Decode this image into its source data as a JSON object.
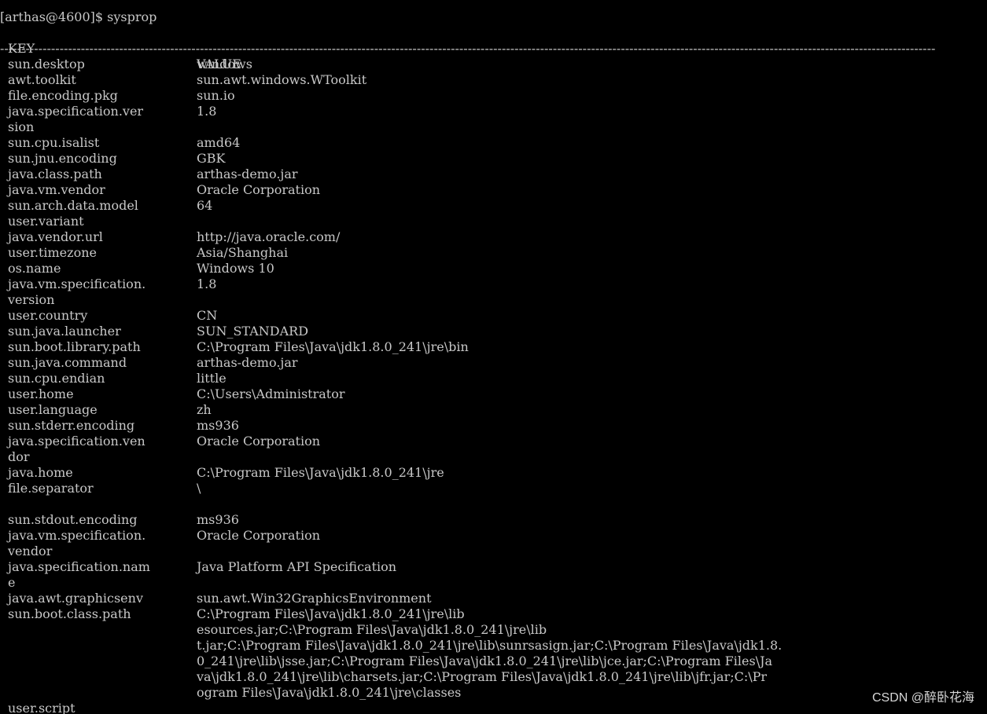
{
  "terminal": {
    "prompt": "[arthas@4600]$ ",
    "command": "sysprop",
    "header": {
      "key": "KEY",
      "value": "VALUE"
    },
    "separator": "----------------------------------------------------------------------------------------------------------------------------------------------------------------------------------------------------------------------------",
    "rows": [
      {
        "key": "sun.desktop",
        "value": "windows"
      },
      {
        "key": "awt.toolkit",
        "value": "sun.awt.windows.WToolkit"
      },
      {
        "key": "file.encoding.pkg",
        "value": "sun.io"
      },
      {
        "key": "java.specification.ver",
        "value": "1.8"
      },
      {
        "key": "sion",
        "value": ""
      },
      {
        "key": "sun.cpu.isalist",
        "value": "amd64"
      },
      {
        "key": "sun.jnu.encoding",
        "value": "GBK"
      },
      {
        "key": "java.class.path",
        "value": "arthas-demo.jar"
      },
      {
        "key": "java.vm.vendor",
        "value": "Oracle Corporation"
      },
      {
        "key": "sun.arch.data.model",
        "value": "64"
      },
      {
        "key": "user.variant",
        "value": ""
      },
      {
        "key": "java.vendor.url",
        "value": "http://java.oracle.com/"
      },
      {
        "key": "user.timezone",
        "value": "Asia/Shanghai"
      },
      {
        "key": "os.name",
        "value": "Windows 10"
      },
      {
        "key": "java.vm.specification.",
        "value": "1.8"
      },
      {
        "key": "version",
        "value": ""
      },
      {
        "key": "user.country",
        "value": "CN"
      },
      {
        "key": "sun.java.launcher",
        "value": "SUN_STANDARD"
      },
      {
        "key": "sun.boot.library.path",
        "value": "C:\\Program Files\\Java\\jdk1.8.0_241\\jre\\bin"
      },
      {
        "key": "sun.java.command",
        "value": "arthas-demo.jar"
      },
      {
        "key": "sun.cpu.endian",
        "value": "little"
      },
      {
        "key": "user.home",
        "value": "C:\\Users\\Administrator"
      },
      {
        "key": "user.language",
        "value": "zh"
      },
      {
        "key": "sun.stderr.encoding",
        "value": "ms936"
      },
      {
        "key": "java.specification.ven",
        "value": "Oracle Corporation"
      },
      {
        "key": "dor",
        "value": ""
      },
      {
        "key": "java.home",
        "value": "C:\\Program Files\\Java\\jdk1.8.0_241\\jre"
      },
      {
        "key": "file.separator",
        "value": "\\"
      },
      {
        "key": "",
        "value": ""
      },
      {
        "key": "sun.stdout.encoding",
        "value": "ms936"
      },
      {
        "key": "java.vm.specification.",
        "value": "Oracle Corporation"
      },
      {
        "key": "vendor",
        "value": ""
      },
      {
        "key": "java.specification.nam",
        "value": "Java Platform API Specification"
      },
      {
        "key": "e",
        "value": ""
      },
      {
        "key": "java.awt.graphicsenv",
        "value": "sun.awt.Win32GraphicsEnvironment"
      },
      {
        "key": "sun.boot.class.path",
        "value": "C:\\Program Files\\Java\\jdk1.8.0_241\\jre\\lib"
      },
      {
        "key": "",
        "value": "esources.jar;C:\\Program Files\\Java\\jdk1.8.0_241\\jre\\lib"
      },
      {
        "key": "",
        "value": "t.jar;C:\\Program Files\\Java\\jdk1.8.0_241\\jre\\lib\\sunrsasign.jar;C:\\Program Files\\Java\\jdk1.8."
      },
      {
        "key": "",
        "value": "0_241\\jre\\lib\\jsse.jar;C:\\Program Files\\Java\\jdk1.8.0_241\\jre\\lib\\jce.jar;C:\\Program Files\\Ja"
      },
      {
        "key": "",
        "value": "va\\jdk1.8.0_241\\jre\\lib\\charsets.jar;C:\\Program Files\\Java\\jdk1.8.0_241\\jre\\lib\\jfr.jar;C:\\Pr"
      },
      {
        "key": "",
        "value": "ogram Files\\Java\\jdk1.8.0_241\\jre\\classes"
      },
      {
        "key": "user.script",
        "value": ""
      }
    ]
  },
  "watermark": "CSDN @醉卧花海"
}
